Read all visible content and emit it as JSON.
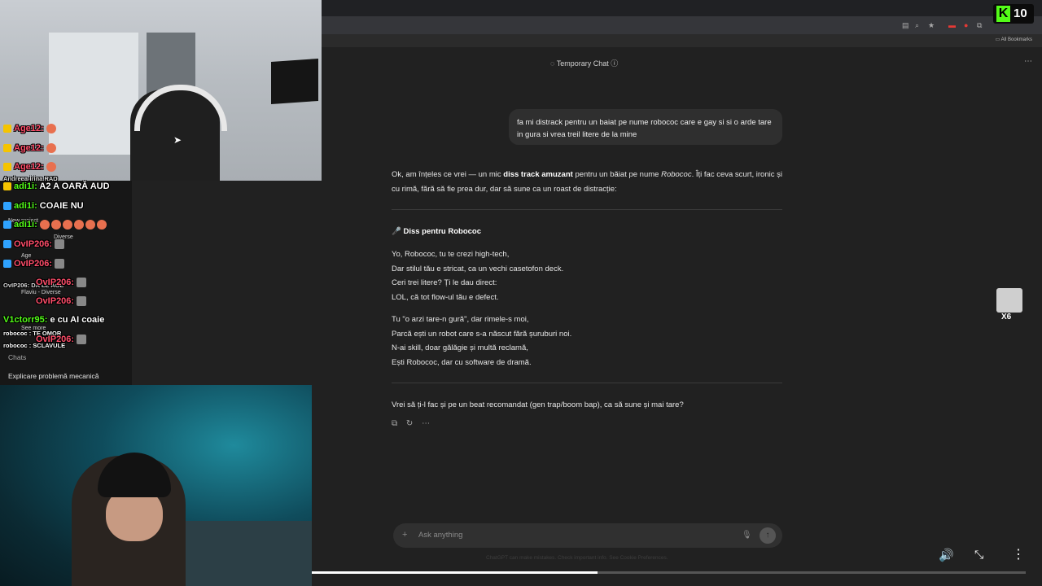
{
  "browser": {
    "bookmarks_label": "All Bookmarks"
  },
  "chat": {
    "temporary_chat_label": "Temporary Chat",
    "user_message": "fa mi distrack pentru un baiat pe nume robococ care e gay si si o arde tare in gura si vrea treil litere de la mine",
    "response_intro_1": "Ok, am înțeles ce vrei — un mic ",
    "response_intro_bold": "diss track amuzant",
    "response_intro_2": " pentru un băiat pe nume ",
    "response_intro_italic": "Robococ",
    "response_intro_3": ". Îți fac ceva scurt, ironic și cu rimă, fără să fie prea dur, dar să sune ca un roast de distracție:",
    "diss_title": "🎤 Diss pentru Robococ",
    "verse1": [
      "Yo, Robococ, tu te crezi high-tech,",
      "Dar stilul tău e stricat, ca un vechi casetofon deck.",
      "Ceri trei litere? Ți le dau direct:",
      "LOL, că tot flow-ul tău e defect."
    ],
    "verse2": [
      "Tu \"o arzi tare-n gură\", dar rimele-s moi,",
      "Parcă ești un robot care s-a născut fără șuruburi noi.",
      "N-ai skill, doar gălăgie și multă reclamă,",
      "Ești Robococ, dar cu software de dramă."
    ],
    "followup": "Vrei să ți-l fac și pe un beat recomandat (gen trap/boom bap), ca să sune și mai tare?",
    "composer_placeholder": "Ask anything",
    "disclaimer": "ChatGPT can make mistakes. Check important info. See Cookie Preferences."
  },
  "sidebar": {
    "section_label": "Chats",
    "items": [
      "Explicare problemă mecanică"
    ]
  },
  "stream": {
    "kick_viewers": "10",
    "avatar_count": "X6",
    "progress_percent": 40,
    "chat_messages": [
      {
        "user": "Age12:",
        "text": ""
      },
      {
        "user": "Age12:",
        "text": ""
      },
      {
        "user": "Age12:",
        "text": ""
      },
      {
        "user": "adi1i:",
        "text": "A2 A OARĂ AUD"
      },
      {
        "user": "adi1i:",
        "text": "COAIE NU"
      },
      {
        "user": "adi1i:",
        "text": ""
      },
      {
        "user": "OvIP206:",
        "text": ""
      },
      {
        "user": "OvIP206:",
        "text": ""
      },
      {
        "user": "OvIP206:",
        "text": ""
      },
      {
        "user": "OvIP206:",
        "text": ""
      },
      {
        "user": "V1ctorr95:",
        "text": "e cu AI coaie"
      },
      {
        "user": "OvIP206:",
        "text": ""
      }
    ],
    "small_chat": [
      {
        "user": "Andreea-irina",
        "text": "RAD"
      },
      {
        "user": "OvIP206",
        "text": ": DA LE AGE"
      },
      {
        "user": "robococ",
        "text": ": TE OMOR"
      },
      {
        "user": "robococ",
        "text": ": SCLAVULE"
      }
    ],
    "sidebar_ghosts": [
      "New project",
      "Age",
      "Diverse",
      "Flaviu - Diverse",
      "See more"
    ]
  },
  "colors": {
    "background": "#212121",
    "kick_green": "#53fc18",
    "bubble": "#2f2f2f"
  }
}
